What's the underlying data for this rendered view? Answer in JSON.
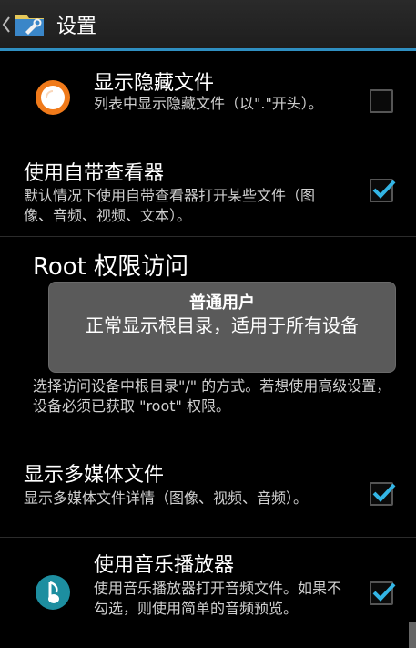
{
  "header": {
    "title": "设置"
  },
  "prefs": [
    {
      "title": "显示隐藏文件",
      "summary": "列表中显示隐藏文件（以\".\"开头）。",
      "checked": false
    },
    {
      "title": "使用自带查看器",
      "summary": "默认情况下使用自带查看器打开某些文件（图像、音频、视频、文本）。",
      "checked": true
    },
    {
      "title": "Root 权限访问",
      "summary": "选择访问设备中根目录\"/\" 的方式。若想使用高级设置，设备必须已获取 \"root\" 权限。"
    },
    {
      "title": "显示多媒体文件",
      "summary": "显示多媒体文件详情（图像、视频、音频）。",
      "checked": true
    },
    {
      "title": "使用音乐播放器",
      "summary": "使用音乐播放器打开音频文件。如果不勾选，则使用简单的音频预览。",
      "checked": true
    }
  ],
  "toast": {
    "title": "普通用户",
    "message": "正常显示根目录，适用于所有设备"
  },
  "colors": {
    "accent": "#2f8fc1",
    "check": "#33b5e5",
    "toast_bg": "#5a5a5a"
  },
  "icons": {
    "hidden_files": "orange-circle-icon",
    "music_player": "music-note-icon",
    "app": "folder-app-icon"
  }
}
